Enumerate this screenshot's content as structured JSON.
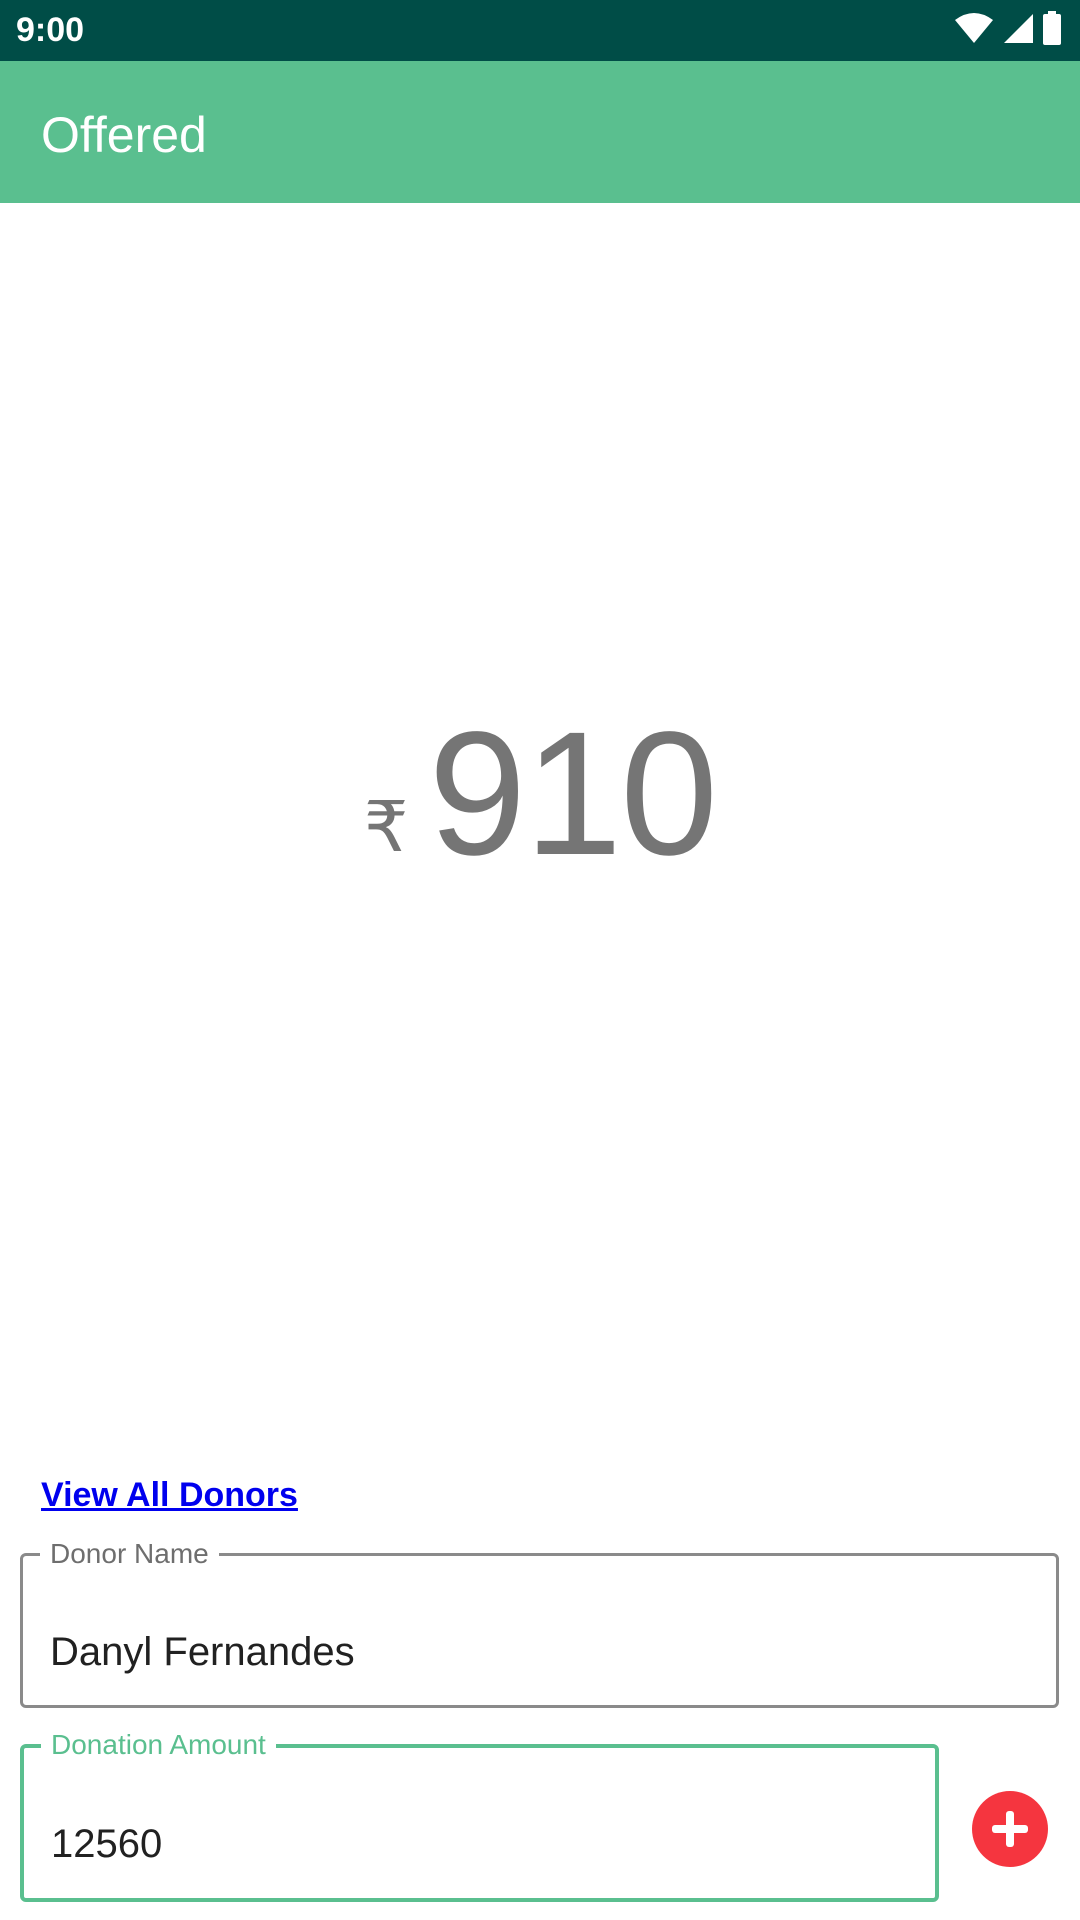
{
  "status_bar": {
    "time": "9:00",
    "icons": [
      "wifi-icon",
      "signal-icon",
      "battery-icon"
    ]
  },
  "app_bar": {
    "title": "Offered"
  },
  "offered": {
    "currency_symbol": "₹",
    "amount": "910"
  },
  "view_all_donors": "View All Donors",
  "donor_name_field": {
    "label": "Donor Name",
    "value": "Danyl Fernandes"
  },
  "donation_amount_field": {
    "label": "Donation Amount",
    "value": "12560"
  },
  "add_button": {
    "icon": "plus-icon"
  },
  "colors": {
    "status_bar": "#004d47",
    "app_bar": "#5abf8f",
    "accent": "#5abf8f",
    "add_button": "#f5353f",
    "link": "#0000ee",
    "amount_text": "#757575"
  }
}
